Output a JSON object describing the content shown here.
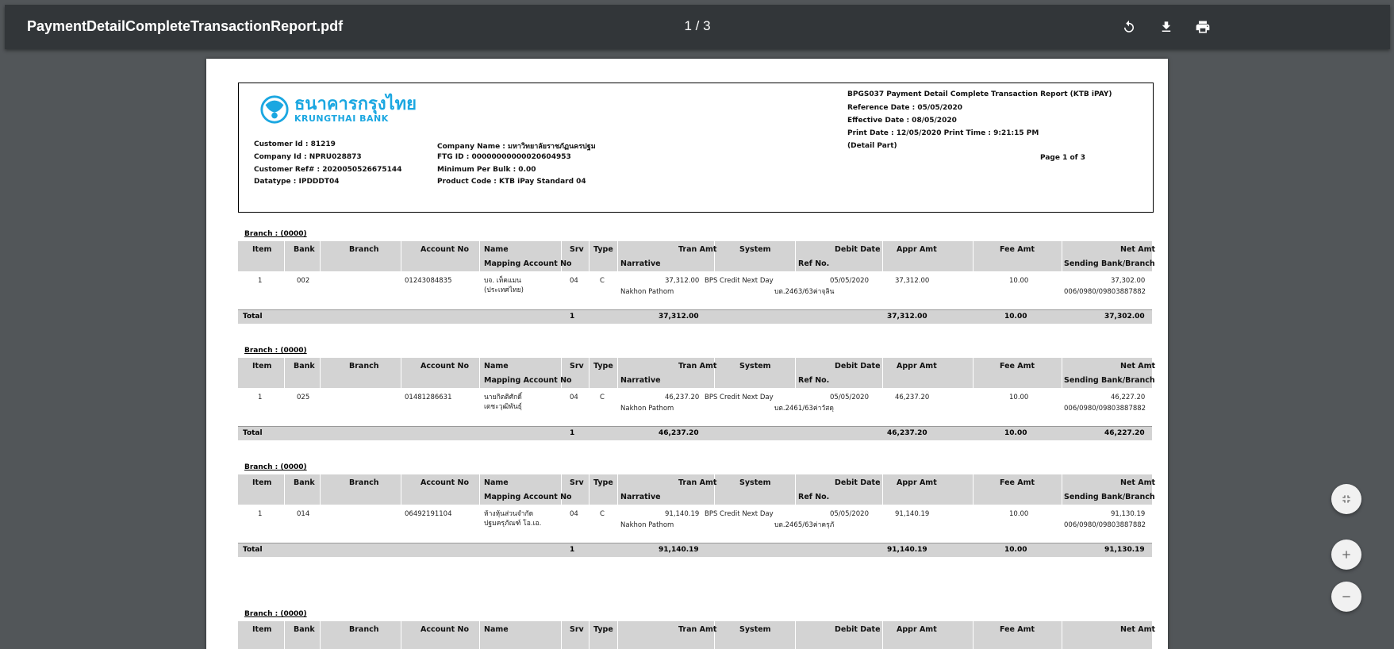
{
  "toolbar": {
    "file_name": "PaymentDetailCompleteTransactionReport.pdf",
    "page_indicator": "1 / 3",
    "icons": [
      "rotate-icon",
      "download-icon",
      "print-icon"
    ]
  },
  "report": {
    "logo_thai": "ธนาคารกรุงไทย",
    "logo_english": "KRUNGTHAI BANK",
    "title": "BPGS037 Payment Detail Complete Transaction Report (KTB iPAY)",
    "reference_date": "Reference Date :  05/05/2020",
    "effective_date": "Effective Date :  08/05/2020",
    "print_date": "Print Date :  12/05/2020     Print Time :  9:21:15 PM",
    "part": "(Detail Part)",
    "page_info": "Page   1   of   3",
    "customer_id": "Customer Id :  81219",
    "company_id": "Company Id :  NPRU028873",
    "customer_ref": "Customer Ref# :  2020050526675144",
    "datatype": "Datatype :  IPDDDT04",
    "company_name": "Company Name :  มหาวิทยาลัยราชภัฏนครปฐม",
    "ftg_id": "FTG ID :  00000000000020604953",
    "min_per_bulk": "Minimum Per Bulk :  0.00",
    "product_code": "Product Code :  KTB iPay Standard 04"
  },
  "columns": {
    "item": "Item",
    "bank": "Bank",
    "branch": "Branch",
    "account_no": "Account No",
    "name": "Name",
    "mapping": "Mapping Account No",
    "srv": "Srv",
    "type": "Type",
    "tran_amt": "Tran Amt",
    "narrative": "Narrative",
    "system": "System",
    "debit_date": "Debit Date",
    "ref_no": "Ref No.",
    "appr_amt": "Appr Amt",
    "fee_amt": "Fee Amt",
    "net_amt": "Net Amt",
    "sending_bank": "Sending Bank/Branch"
  },
  "sections": [
    {
      "branch_label": "Branch :  (0000)",
      "row": {
        "item": "1",
        "bank": "002",
        "account_no": "01243084835",
        "name1": "บจ. เท็คแมน",
        "name2": "(ประเทศไทย)",
        "srv": "04",
        "type": "C",
        "tran_amt": "37,312.00",
        "narrative": "Nakhon Pathom",
        "system": "BPS Credit Next Day",
        "debit_date": "05/05/2020",
        "ref_no": "บต.2463/63ค่าจุลิน",
        "appr_amt": "37,312.00",
        "fee_amt": "10.00",
        "net_amt": "37,302.00",
        "sending_bank": "006/0980/09803887882"
      },
      "total": {
        "label": "Total",
        "count": "1",
        "tran_amt": "37,312.00",
        "appr_amt": "37,312.00",
        "fee_amt": "10.00",
        "net_amt": "37,302.00"
      }
    },
    {
      "branch_label": "Branch :  (0000)",
      "row": {
        "item": "1",
        "bank": "025",
        "account_no": "01481286631",
        "name1": "นายกิตติศักดิ์",
        "name2": "เตชะวุฒิพันธุ์",
        "srv": "04",
        "type": "C",
        "tran_amt": "46,237.20",
        "narrative": "Nakhon Pathom",
        "system": "BPS Credit Next Day",
        "debit_date": "05/05/2020",
        "ref_no": "บต.2461/63ค่าวัสดุ",
        "appr_amt": "46,237.20",
        "fee_amt": "10.00",
        "net_amt": "46,227.20",
        "sending_bank": "006/0980/09803887882"
      },
      "total": {
        "label": "Total",
        "count": "1",
        "tran_amt": "46,237.20",
        "appr_amt": "46,237.20",
        "fee_amt": "10.00",
        "net_amt": "46,227.20"
      }
    },
    {
      "branch_label": "Branch :  (0000)",
      "row": {
        "item": "1",
        "bank": "014",
        "account_no": "06492191104",
        "name1": "ห้างหุ้นส่วนจำกัด",
        "name2": "ปฐมครุภัณฑ์ โอ.เอ.",
        "srv": "04",
        "type": "C",
        "tran_amt": "91,140.19",
        "narrative": "Nakhon Pathom",
        "system": "BPS Credit Next Day",
        "debit_date": "05/05/2020",
        "ref_no": "บต.2465/63ค่าครุภั",
        "appr_amt": "91,140.19",
        "fee_amt": "10.00",
        "net_amt": "91,130.19",
        "sending_bank": "006/0980/09803887882"
      },
      "total": {
        "label": "Total",
        "count": "1",
        "tran_amt": "91,140.19",
        "appr_amt": "91,140.19",
        "fee_amt": "10.00",
        "net_amt": "91,130.19"
      }
    },
    {
      "branch_label": "Branch :  (0000)"
    }
  ],
  "controls": {
    "fit_icon": "fit-page-icon",
    "zoom_in_icon": "zoom-in-icon",
    "zoom_out_icon": "zoom-out-icon"
  }
}
